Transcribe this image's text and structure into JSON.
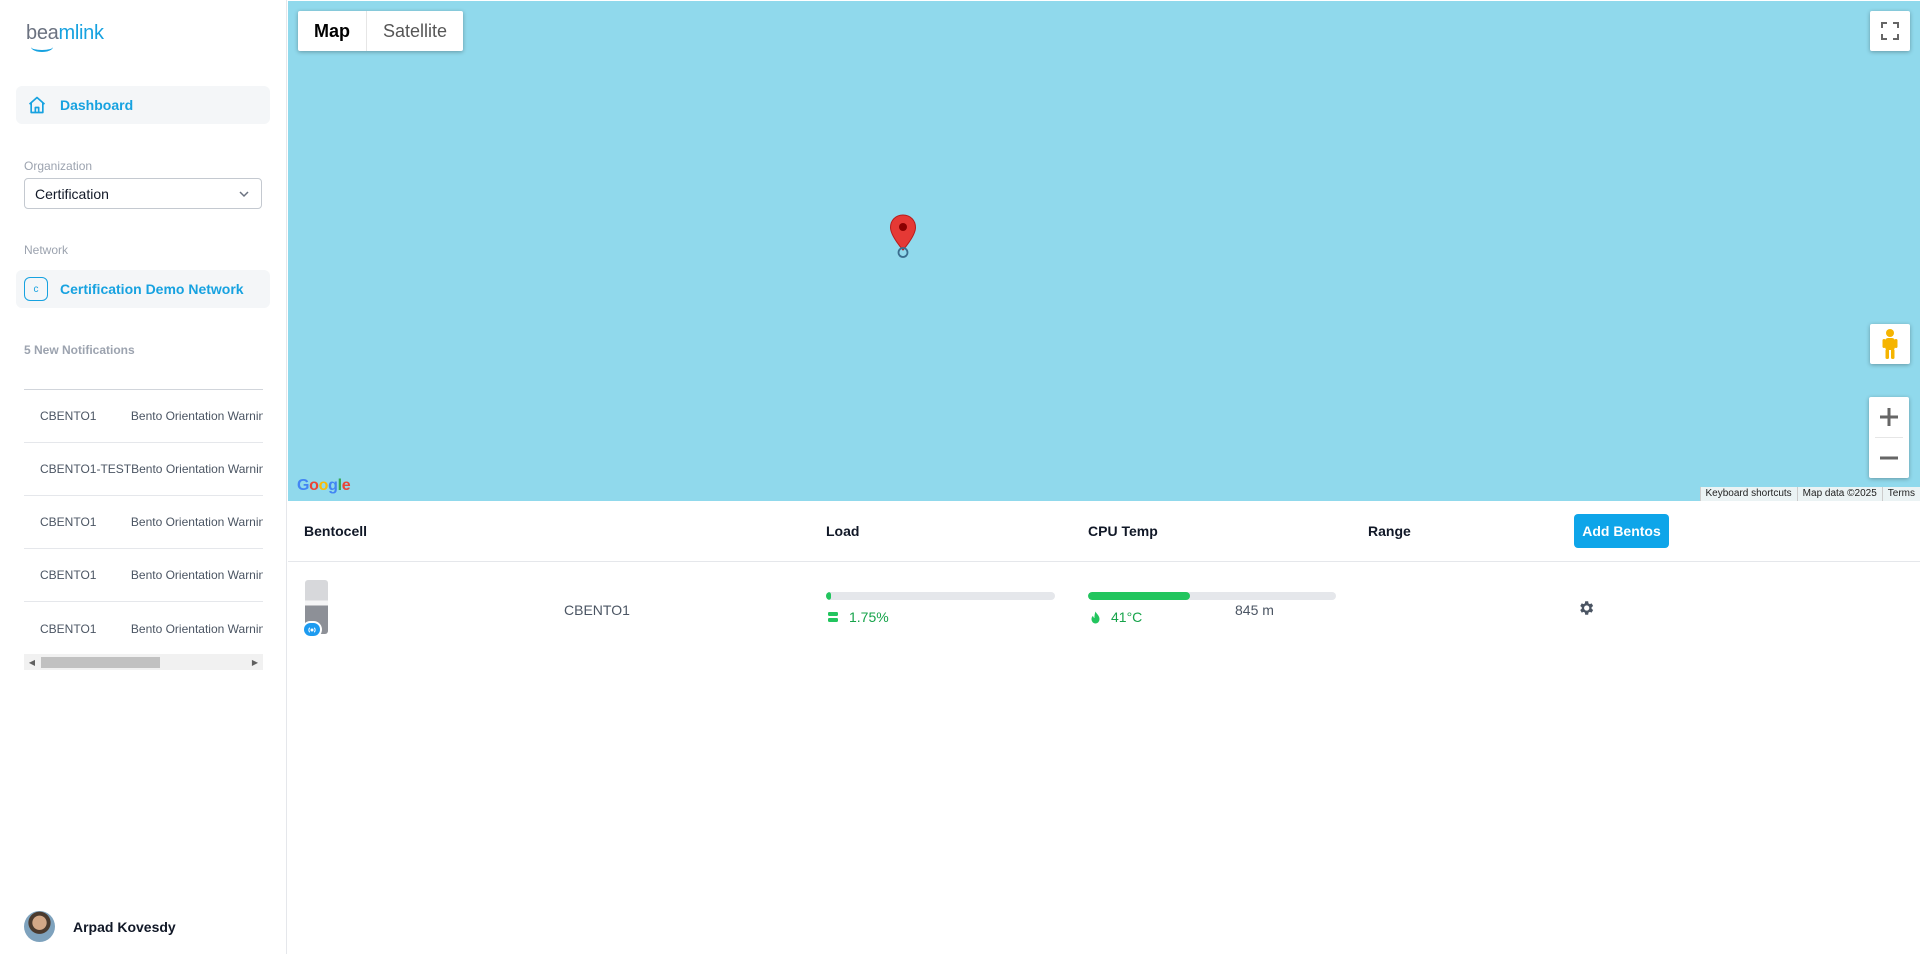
{
  "sidebar": {
    "logo": {
      "part1": "bea",
      "part2": "mlink"
    },
    "dashboard_label": "Dashboard",
    "organization_label": "Organization",
    "organization_value": "Certification",
    "network_label": "Network",
    "network_badge": "c",
    "network_name": "Certification Demo Network",
    "notifications_label": "5 New Notifications",
    "notifications": [
      {
        "device": "CBENTO1",
        "message": "Bento Orientation Warning"
      },
      {
        "device": "CBENTO1-TEST",
        "message": "Bento Orientation Warning"
      },
      {
        "device": "CBENTO1",
        "message": "Bento Orientation Warning"
      },
      {
        "device": "CBENTO1",
        "message": "Bento Orientation Warning"
      },
      {
        "device": "CBENTO1",
        "message": "Bento Orientation Warning"
      }
    ],
    "user_name": "Arpad Kovesdy"
  },
  "map": {
    "type_options": [
      "Map",
      "Satellite"
    ],
    "selected_type": "Map",
    "attribution": [
      "Keyboard shortcuts",
      "Map data ©2025",
      "Terms"
    ],
    "background_color": "#90d9ec",
    "marker_color": "#e53935"
  },
  "table": {
    "headers": {
      "bentocell": "Bentocell",
      "load": "Load",
      "cpu_temp": "CPU Temp",
      "range": "Range"
    },
    "add_button": "Add Bentos",
    "rows": [
      {
        "name": "CBENTO1",
        "load_text": "1.75%",
        "load_fraction": 0.0175,
        "cpu_text": "41°C",
        "cpu_fraction": 0.41,
        "range": "845 m"
      }
    ]
  },
  "colors": {
    "accent": "#17a2e0",
    "button": "#0ea5e9",
    "success": "#22c55e"
  }
}
